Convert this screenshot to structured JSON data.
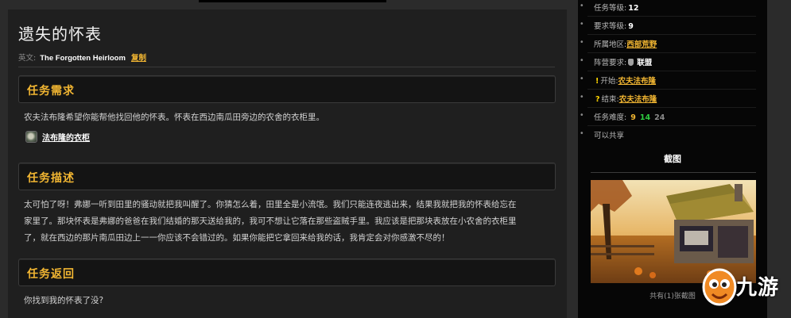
{
  "quest": {
    "title": "遗失的怀表",
    "english_label": "英文:",
    "english_name": "The Forgotten Heirloom",
    "copy_label": "复制"
  },
  "sections": {
    "requirements": {
      "heading": "任务需求",
      "text": "农夫法布隆希望你能帮他找回他的怀表。怀表在西边南瓜田旁边的农舍的衣柜里。",
      "npc_link": "法布隆的衣柜"
    },
    "description": {
      "heading": "任务描述",
      "line1": "太可怕了呀！弗娜一听到田里的骚动就把我叫醒了。你猜怎么着，田里全是小流氓。我们只能连夜逃出来，结果我就把我的怀表给忘在",
      "line2": "家里了。那块怀表是弗娜的爸爸在我们结婚的那天送给我的，我可不想让它落在那些盗贼手里。我应该是把那块表放在小农舍的衣柜里",
      "line3": "了，就在西边的那片南瓜田边上一一你应该不会错过的。如果你能把它拿回来给我的话，我肯定会对你感激不尽的！"
    },
    "return": {
      "heading": "任务返回",
      "text": "你找到我的怀表了没?"
    }
  },
  "sidebar": {
    "info": {
      "level_label": "任务等级:",
      "level_value": "12",
      "req_label": "要求等级:",
      "req_value": "9",
      "zone_label": "所属地区:",
      "zone_value": "西部荒野",
      "faction_label": "阵营要求:",
      "faction_value": "联盟",
      "start_label": "开始:",
      "start_value": "农夫法布隆",
      "end_label": "结束:",
      "end_value": "农夫法布隆",
      "diff_label": "任务难度:",
      "diff_1": "9",
      "diff_2": "14",
      "diff_3": "24",
      "share_label": "可以共享"
    },
    "screenshot_title": "截图",
    "screenshot_count": "共有(1)张截图"
  },
  "logo": {
    "text": "九游"
  },
  "colors": {
    "accent": "#f2b632",
    "page_bg": "#2b2b2b",
    "panel_bg": "#1f1f1f",
    "sidebar_bg": "#060606",
    "difficulty_green": "#2ecc40",
    "difficulty_grey": "#8a8a8a"
  }
}
